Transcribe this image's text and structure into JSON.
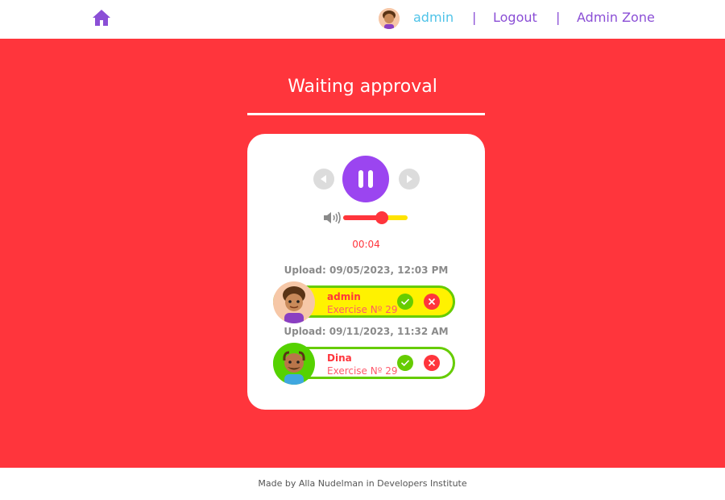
{
  "header": {
    "home_icon": "home-icon",
    "username": "admin",
    "separator": "|",
    "logout_label": "Logout",
    "admin_zone_label": "Admin Zone"
  },
  "main": {
    "title": "Waiting approval",
    "player": {
      "time": "00:04",
      "volume": 0.6,
      "state": "playing"
    },
    "submissions": [
      {
        "upload_label": "Upload: 09/05/2023, 12:03 PM",
        "name": "admin",
        "exercise": "Exercise Nº 29",
        "selected": true
      },
      {
        "upload_label": "Upload: 09/11/2023, 11:32 AM",
        "name": "Dina",
        "exercise": "Exercise Nº 29",
        "selected": false
      }
    ]
  },
  "footer": {
    "text": "Made by Alla Nudelman in Developers Institute"
  },
  "colors": {
    "background": "#ff353c",
    "accent_purple": "#9b45f0",
    "approve_green": "#66cc00",
    "highlight_yellow": "#fff200",
    "nav_cyan": "#4fc3e8"
  }
}
